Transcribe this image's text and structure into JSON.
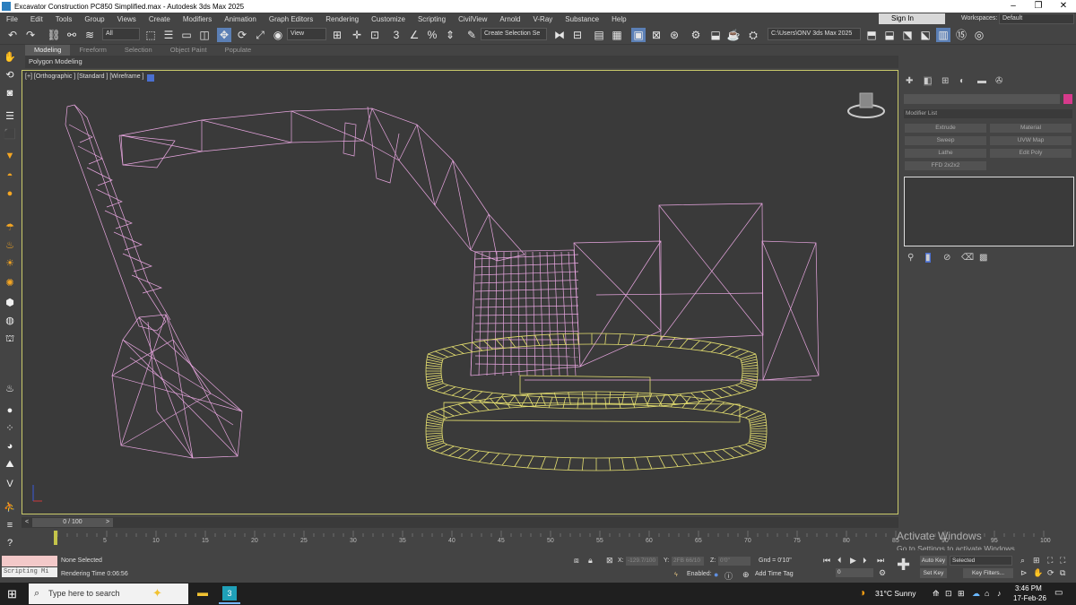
{
  "window": {
    "title": "Excavator Construction PC850 Simplified.max - Autodesk 3ds Max 2025",
    "controls": [
      "–",
      "❐",
      "✕"
    ]
  },
  "menu": [
    "File",
    "Edit",
    "Tools",
    "Group",
    "Views",
    "Create",
    "Modifiers",
    "Animation",
    "Graph Editors",
    "Rendering",
    "Customize",
    "Scripting",
    "CivilView",
    "Arnold",
    "V-Ray",
    "Substance",
    "Help"
  ],
  "signin": "Sign In",
  "workspaces": {
    "label": "Workspaces:",
    "value": "Default"
  },
  "toolbar": {
    "filter_value": "All",
    "view_value": "View",
    "selection_set": "Create Selection Se",
    "project_path": "C:\\Users\\ONV  3ds Max 2025"
  },
  "ribbon": {
    "tabs": [
      "Modeling",
      "Freeform",
      "Selection",
      "Object Paint",
      "Populate"
    ],
    "active_tab": "Modeling",
    "sub_label": "Polygon Modeling"
  },
  "viewport": {
    "label": "[+] [Orthographic ] [Standard ] [Wireframe ]"
  },
  "command_panel": {
    "modifier_list": "Modifier List",
    "buttons": [
      "Extrude",
      "Material",
      "Sweep",
      "UVW Map",
      "Lathe",
      "Edit Poly",
      "FFD 2x2x2"
    ]
  },
  "time_slider": {
    "position": "0 / 100",
    "prev": "<",
    "next": ">"
  },
  "track_ticks": [
    "5",
    "10",
    "15",
    "20",
    "25",
    "30",
    "35",
    "40",
    "45",
    "50",
    "55",
    "60",
    "65",
    "70",
    "75",
    "80",
    "85",
    "90",
    "95",
    "100"
  ],
  "status": {
    "script_label": "Scripting Mi",
    "selection": "None Selected",
    "render_time": "Rendering Time  0:06:56",
    "x_label": "X:",
    "x_value": "-129.7/100",
    "y_label": "Y:",
    "y_value": "2FB 66/10",
    "z_label": "Z:",
    "z_value": "0'0\"",
    "grid": "Gnd = 0'10\"",
    "enabled_label": "Enabled:",
    "add_time_tag": "Add Time Tag",
    "auto_key": "Auto Key",
    "selected": "Selected",
    "set_key": "Set Key",
    "key_filters": "Key Filters...",
    "frame_value": "0"
  },
  "watermark": {
    "line1": "Activate Windows",
    "line2": "Go to Settings to activate Windows."
  },
  "taskbar": {
    "search_placeholder": "Type here to search",
    "weather": "31°C  Sunny",
    "time": "3:46 PM",
    "date": "17-Feb-26"
  },
  "colors": {
    "mesh_pink": "#e8a6e0",
    "mesh_yellow": "#e6e070",
    "viewport_border": "#c9c96a"
  }
}
